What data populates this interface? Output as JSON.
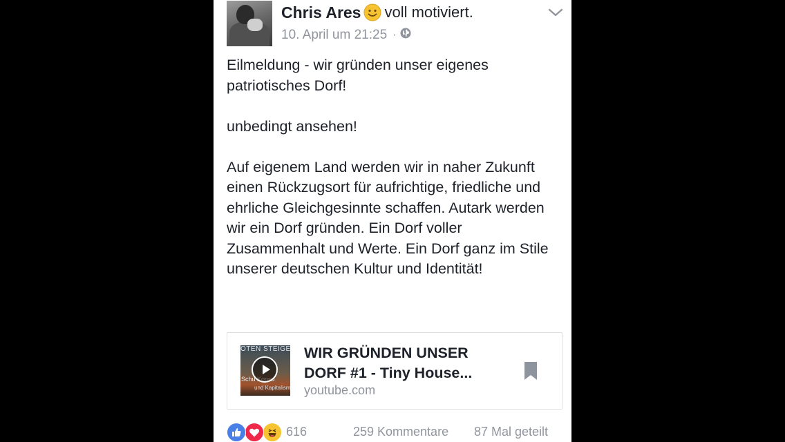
{
  "post": {
    "author": "Chris Ares",
    "feeling_emoji": "smiling-face-icon",
    "feeling": "voll motiviert.",
    "timestamp": "10. April um 21:25",
    "separator": "·",
    "privacy_icon": "globe-icon",
    "paragraphs": [
      "Eilmeldung - wir gründen unser eigenes patriotisches Dorf!",
      "unbedingt ansehen!",
      "Auf eigenem Land werden wir in naher Zukunft einen Rückzugsort für aufrichtige, friedliche und ehrliche Gleichgesinnte schaffen. Autark werden wir ein Dorf gründen. Ein Dorf voller Zusammenhalt und Werte. Ein Dorf ganz im Stile unserer deutschen Kultur und Identität!"
    ]
  },
  "link_preview": {
    "title": "WIR GRÜNDEN UNSER DORF #1 - Tiny House...",
    "domain": "youtube.com",
    "thumbnail_text_top": "OTEN STEIGE",
    "thumbnail_text_mid": "Schu     Konsu",
    "thumbnail_text_bottom": "und Kapitalism"
  },
  "footer": {
    "reaction_icons": [
      "like-icon",
      "love-icon",
      "haha-icon"
    ],
    "reaction_count": "616",
    "comments": "259 Kommentare",
    "shares": "87 Mal geteilt"
  },
  "colors": {
    "background": "#000000",
    "card": "#ffffff",
    "text": "#1d2129",
    "secondary_text": "#90949c",
    "like": "#4a7fe6",
    "love": "#f0284a",
    "haha": "#f7c330"
  }
}
